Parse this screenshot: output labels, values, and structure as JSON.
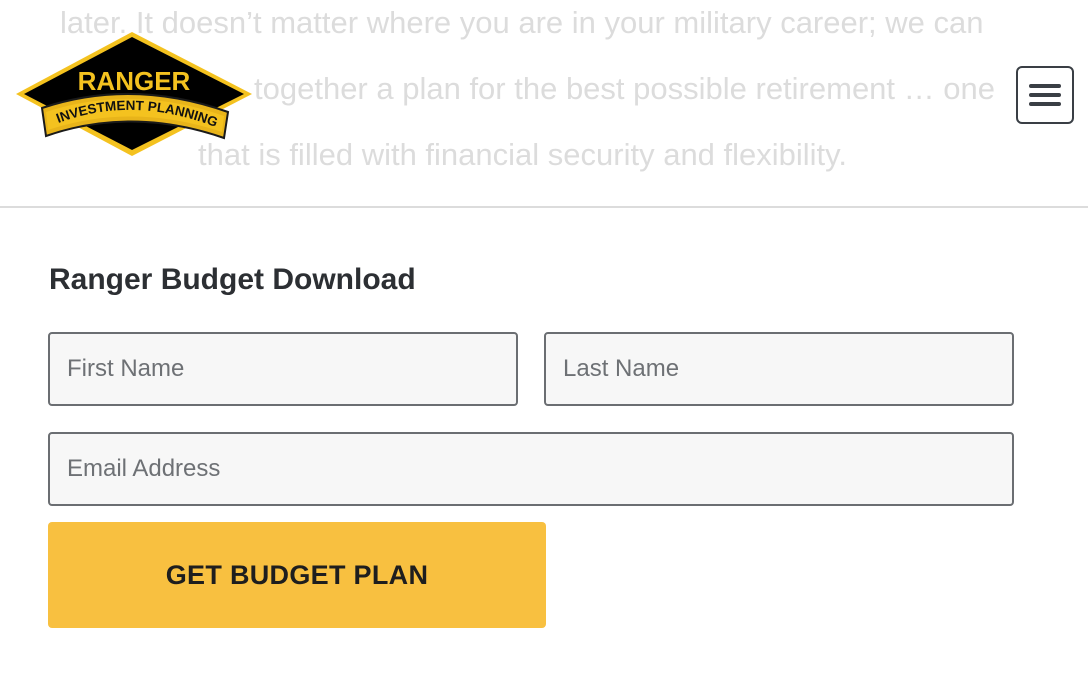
{
  "header": {
    "background_text": [
      "later. It doesn’t matter where you are in your military career; we can",
      "together a plan for the best possible retirement … one",
      "that is filled with financial security and flexibility."
    ],
    "logo": {
      "line1": "RANGER",
      "line2": "INVESTMENT PLANNING",
      "colors": {
        "black": "#000000",
        "gold": "#f4c21f"
      }
    },
    "menu_icon": "hamburger-icon"
  },
  "form": {
    "title": "Ranger Budget Download",
    "first_name_placeholder": "First Name",
    "last_name_placeholder": "Last Name",
    "email_placeholder": "Email Address",
    "submit_label": "GET BUDGET PLAN",
    "accent_color": "#f8c040"
  }
}
